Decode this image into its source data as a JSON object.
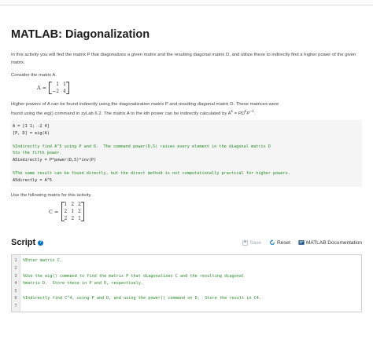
{
  "title": "MATLAB: Diagonalization",
  "intro": "In this activity you will find the matrix P that diagonalizes a given matrix and the resulting diagonal matrix D, and utilize these to indirectly find a higher power of the given matrix.",
  "consider_a": "Consider the matrix A.",
  "matrix_a": {
    "label": "A =",
    "rows": [
      [
        "1",
        "1"
      ],
      [
        "−2",
        "4"
      ]
    ]
  },
  "higher_powers_1": "Higher powers of A can be found indirectly using the diagonalization matrix P and resulting diagonal matrix D.  These matrices were",
  "higher_powers_2": "found using the eig() command in zyLab 6.2.  The matrix A to the kth power can be indirectly calculated by A",
  "formula_k": "k",
  "formula_eq": " = PD",
  "formula_k2": "k",
  "formula_p": "P",
  "formula_inv": "−1",
  "formula_end": ".",
  "code_lines": [
    {
      "text": "A = [1 1; -2 4]",
      "comment": false
    },
    {
      "text": "[P, D] = eig(A)",
      "comment": false
    },
    {
      "text": "",
      "comment": false
    },
    {
      "text": "%Indirectly find A^5 using P and D.  The command power(D,5) raises every element in the diagonal matrix D",
      "comment": true
    },
    {
      "text": "%to the fifth power.",
      "comment": true
    },
    {
      "text": "A5indirectly = P*power(D,5)*inv(P)",
      "comment": false
    },
    {
      "text": "",
      "comment": false
    },
    {
      "text": "%The same result can be found directly, but the direct method is not computationally practical for higher powers.",
      "comment": true
    },
    {
      "text": "A5directly = A^5",
      "comment": false
    }
  ],
  "use_following": "Use the following matrix for this activity.",
  "matrix_c": {
    "label": "C =",
    "rows": [
      [
        "1",
        "2",
        "2"
      ],
      [
        "2",
        "1",
        "2"
      ],
      [
        "2",
        "2",
        "1"
      ]
    ]
  },
  "script": {
    "heading": "Script",
    "help_icon": "?",
    "save_label": "Save",
    "reset_label": "Reset",
    "doc_label": "MATLAB Documentation"
  },
  "editor_lines": [
    {
      "num": "1",
      "text": "%Enter matrix C."
    },
    {
      "num": "2",
      "text": ""
    },
    {
      "num": "3",
      "text": "%Use the eig() command to find the matrix P that diagonalizes C and the resulting diagonal"
    },
    {
      "num": "4",
      "text": "%matrix D.  Store these in P and D, respectively."
    },
    {
      "num": "5",
      "text": ""
    },
    {
      "num": "6",
      "text": "%Indirectly find C^4, using P and D, and using the power() command on D.  Store the result in C4."
    },
    {
      "num": "7",
      "text": ""
    }
  ]
}
